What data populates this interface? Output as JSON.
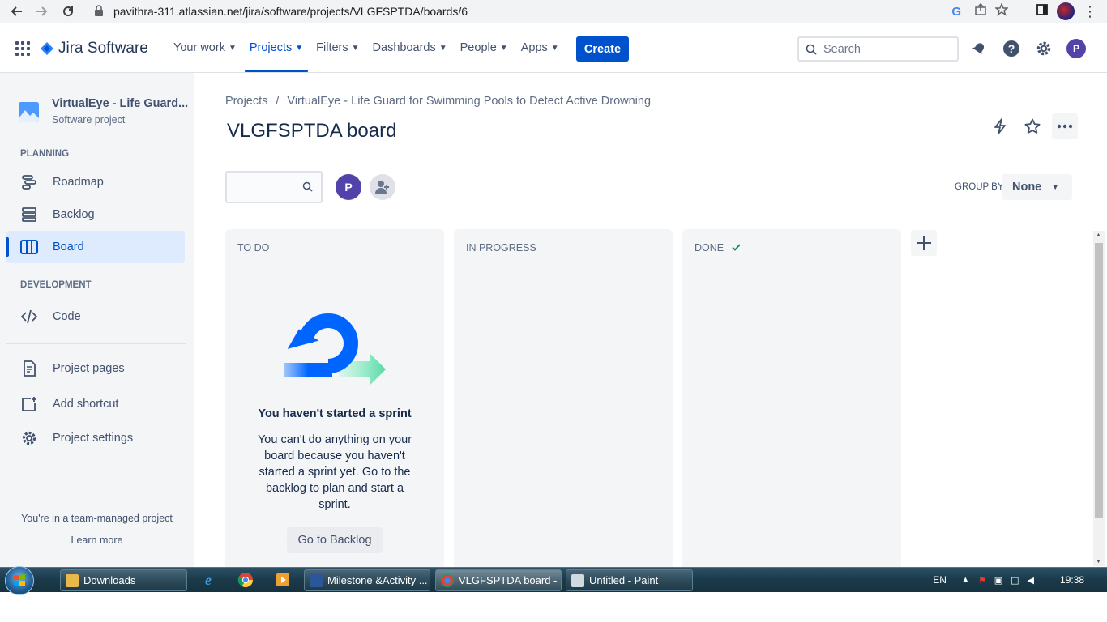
{
  "browser": {
    "url": "pavithra-311.atlassian.net/jira/software/projects/VLGFSPTDA/boards/6"
  },
  "topnav": {
    "logo_text": "Jira Software",
    "items": [
      {
        "label": "Your work"
      },
      {
        "label": "Projects"
      },
      {
        "label": "Filters"
      },
      {
        "label": "Dashboards"
      },
      {
        "label": "People"
      },
      {
        "label": "Apps"
      }
    ],
    "active_item": "Projects",
    "create_label": "Create",
    "search_placeholder": "Search",
    "user_initial": "P",
    "accent_color": "#0052cc"
  },
  "sidebar": {
    "project_name": "VirtualEye - Life Guard...",
    "project_type": "Software project",
    "planning_heading": "PLANNING",
    "planning_items": [
      {
        "label": "Roadmap",
        "icon": "roadmap-icon"
      },
      {
        "label": "Backlog",
        "icon": "backlog-icon"
      },
      {
        "label": "Board",
        "icon": "board-icon"
      }
    ],
    "development_heading": "DEVELOPMENT",
    "code_label": "Code",
    "other_items": [
      {
        "label": "Project pages",
        "icon": "page-icon"
      },
      {
        "label": "Add shortcut",
        "icon": "add-shortcut-icon"
      },
      {
        "label": "Project settings",
        "icon": "gear-icon"
      }
    ],
    "footer_text": "You're in a team-managed project",
    "learn_more": "Learn more"
  },
  "main": {
    "breadcrumb": [
      "Projects",
      "/",
      "VirtualEye - Life Guard for Swimming Pools to Detect Active Drowning"
    ],
    "title": "VLGFSPTDA board",
    "avatar_initial": "P",
    "group_by_label": "GROUP BY",
    "group_by_value": "None",
    "columns": [
      {
        "title": "TO DO"
      },
      {
        "title": "IN PROGRESS"
      },
      {
        "title": "DONE"
      }
    ],
    "empty_state": {
      "title": "You haven't started a sprint",
      "text": "You can't do anything on your board because you haven't started a sprint yet. Go to the backlog to plan and start a sprint.",
      "button": "Go to Backlog"
    }
  },
  "taskbar": {
    "buttons": [
      {
        "label": "Downloads"
      },
      {
        "label": "Milestone &Activity ..."
      },
      {
        "label": "VLGFSPTDA board - ..."
      },
      {
        "label": "Untitled - Paint"
      }
    ],
    "language": "EN",
    "time": "19:38"
  }
}
